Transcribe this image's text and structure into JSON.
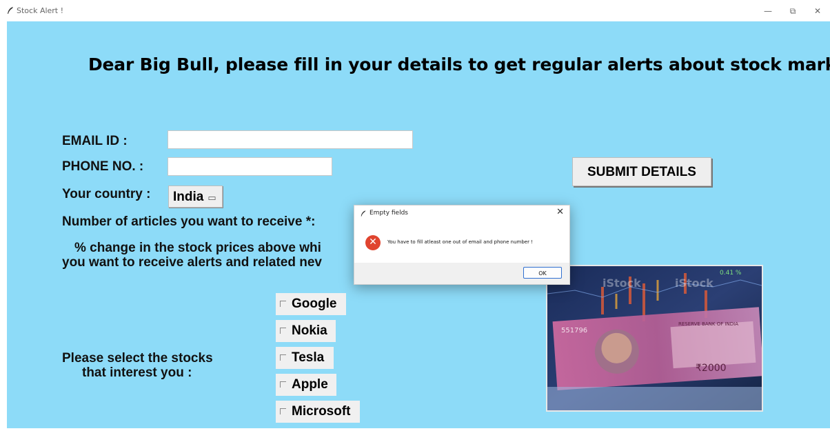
{
  "window": {
    "title": "Stock Alert !",
    "minimize_label": "—",
    "restore_label": "⧉",
    "close_label": "✕"
  },
  "form": {
    "heading": "Dear Big Bull, please fill in your details to get regular alerts about stock market",
    "email_label": "EMAIL ID  :",
    "email_value": "",
    "phone_label": "PHONE NO. :",
    "phone_value": "",
    "country_label": "Your country :",
    "country_value": "India",
    "articles_label": "Number of articles you want to receive *:",
    "percent_label_line1": "% change in the stock prices above whi",
    "percent_label_line2": "you want to receive alerts and related nev",
    "submit_label": "SUBMIT DETAILS",
    "stocks_label_line1": "Please select the stocks",
    "stocks_label_line2": "that interest you :",
    "stocks": [
      {
        "label": "Google",
        "checked": false
      },
      {
        "label": "Nokia",
        "checked": false
      },
      {
        "label": "Tesla",
        "checked": false
      },
      {
        "label": "Apple",
        "checked": false
      },
      {
        "label": "Microsoft",
        "checked": false
      }
    ]
  },
  "image": {
    "watermark_1": "iStock",
    "watermark_2": "iStock",
    "ticker": "0.41 %",
    "bank_text": "RESERVE BANK OF INDIA",
    "note_value": "₹2000",
    "serial": "551796"
  },
  "dialog": {
    "title": "Empty fields",
    "close_label": "✕",
    "message": "You have to fill atleast one out of email and phone number !",
    "ok_label": "OK"
  },
  "colors": {
    "background": "#8ddbf8",
    "error": "#e0442f",
    "ok_border": "#2f6fd0"
  }
}
